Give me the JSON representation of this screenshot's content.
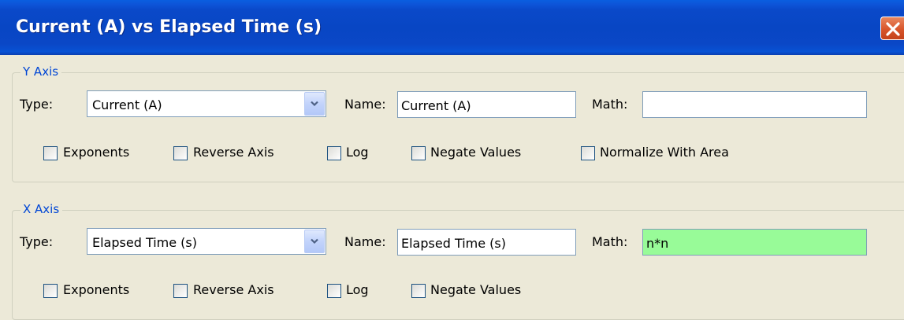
{
  "window": {
    "title": "Current (A) vs Elapsed Time (s)",
    "close_icon": "close-icon"
  },
  "y_axis": {
    "group_label": "Y Axis",
    "type_label": "Type:",
    "type_value": "Current (A)",
    "name_label": "Name:",
    "name_value": "Current (A)",
    "math_label": "Math:",
    "math_value": "",
    "checkboxes": [
      {
        "label": "Exponents",
        "checked": false
      },
      {
        "label": "Reverse Axis",
        "checked": false
      },
      {
        "label": "Log",
        "checked": false
      },
      {
        "label": "Negate Values",
        "checked": false
      },
      {
        "label": "Normalize With Area",
        "checked": false
      }
    ]
  },
  "x_axis": {
    "group_label": "X Axis",
    "type_label": "Type:",
    "type_value": "Elapsed Time (s)",
    "name_label": "Name:",
    "name_value": "Elapsed Time (s)",
    "math_label": "Math:",
    "math_value": "n*n",
    "math_bg": "#98fb98",
    "checkboxes": [
      {
        "label": "Exponents",
        "checked": false
      },
      {
        "label": "Reverse Axis",
        "checked": false
      },
      {
        "label": "Log",
        "checked": false
      },
      {
        "label": "Negate Values",
        "checked": false
      }
    ]
  },
  "colors": {
    "titlebar": "#0846c4",
    "dialog_bg": "#ece9d8",
    "group_label": "#0046d5",
    "field_border": "#7f9db9"
  }
}
